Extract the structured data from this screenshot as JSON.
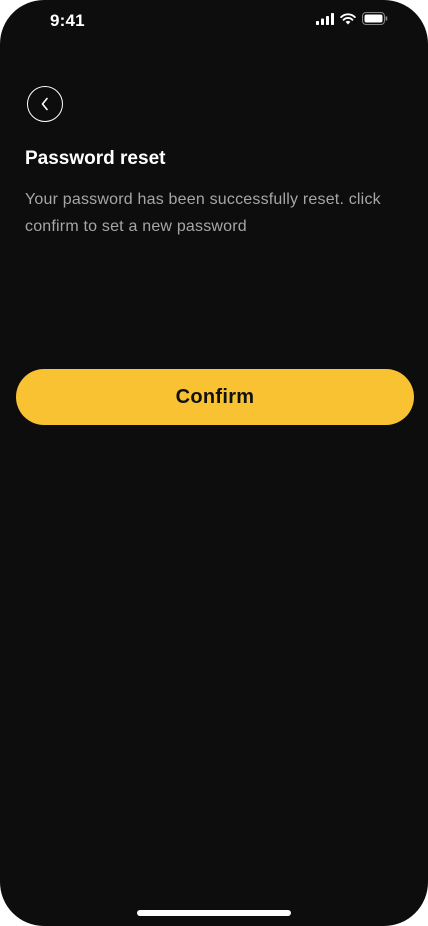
{
  "status_bar": {
    "time": "9:41",
    "signal_icon": "cellular-signal-icon",
    "wifi_icon": "wifi-icon",
    "battery_icon": "battery-icon"
  },
  "header": {
    "back_icon": "chevron-left-icon"
  },
  "main": {
    "title": "Password reset",
    "description": "Your password has been successfully reset. click confirm to set a new password",
    "confirm_label": "Confirm"
  },
  "colors": {
    "background": "#0d0d0d",
    "accent": "#f9c233",
    "text_primary": "#ffffff",
    "text_secondary": "#a6a6a6"
  }
}
